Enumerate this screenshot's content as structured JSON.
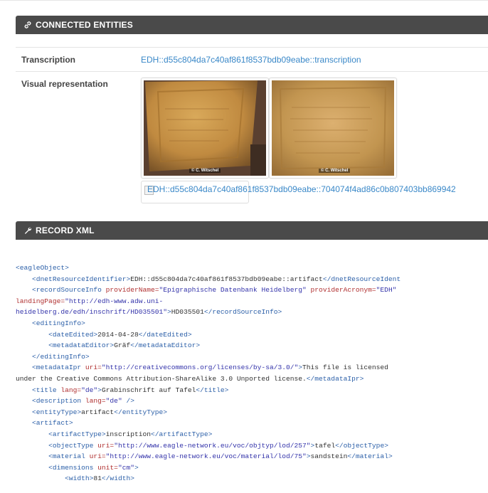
{
  "entities": {
    "title": "CONNECTED ENTITIES",
    "transcription_label": "Transcription",
    "transcription_link": "EDH::d55c804da7c40af861f8537bdb09eabe::transcription",
    "visual_label": "Visual representation",
    "images": [
      {
        "credit": "© C. Witschel"
      },
      {
        "credit": "© C. Witschel"
      }
    ],
    "broken_image_alt": "EDH::d55c804da7c40af861f8537bdb09eabe::704074f4ad86c0b807403bb869942"
  },
  "xml_panel": {
    "title": "RECORD XML",
    "lines": [
      {
        "indent": 0,
        "parts": [
          {
            "c": "tg",
            "t": "<eagleObject>"
          }
        ]
      },
      {
        "indent": 1,
        "parts": [
          {
            "c": "tg",
            "t": "<dnetResourceIdentifier>"
          },
          {
            "c": "tx",
            "t": "EDH::d55c804da7c40af861f8537bdb09eabe::artifact"
          },
          {
            "c": "tg",
            "t": "</dnetResourceIdent"
          }
        ]
      },
      {
        "indent": 1,
        "parts": [
          {
            "c": "tg",
            "t": "<recordSourceInfo "
          },
          {
            "c": "an",
            "t": "providerName="
          },
          {
            "c": "av",
            "t": "\"Epigraphische Datenbank Heidelberg\" "
          },
          {
            "c": "an",
            "t": "providerAcronym="
          },
          {
            "c": "av",
            "t": "\"EDH\""
          }
        ]
      },
      {
        "indent": 0,
        "parts": [
          {
            "c": "an",
            "t": "landingPage="
          },
          {
            "c": "av",
            "t": "\"http://edh-www.adw.uni-"
          }
        ]
      },
      {
        "indent": 0,
        "parts": [
          {
            "c": "av",
            "t": "heidelberg.de/edh/inschrift/HD035501\""
          },
          {
            "c": "tg",
            "t": ">"
          },
          {
            "c": "tx",
            "t": "HD035501"
          },
          {
            "c": "tg",
            "t": "</recordSourceInfo>"
          }
        ]
      },
      {
        "indent": 1,
        "parts": [
          {
            "c": "tg",
            "t": "<editingInfo>"
          }
        ]
      },
      {
        "indent": 2,
        "parts": [
          {
            "c": "tg",
            "t": "<dateEdited>"
          },
          {
            "c": "tx",
            "t": "2014-04-28"
          },
          {
            "c": "tg",
            "t": "</dateEdited>"
          }
        ]
      },
      {
        "indent": 2,
        "parts": [
          {
            "c": "tg",
            "t": "<metadataEditor>"
          },
          {
            "c": "tx",
            "t": "Gräf"
          },
          {
            "c": "tg",
            "t": "</metadataEditor>"
          }
        ]
      },
      {
        "indent": 1,
        "parts": [
          {
            "c": "tg",
            "t": "</editingInfo>"
          }
        ]
      },
      {
        "indent": 1,
        "parts": [
          {
            "c": "tg",
            "t": "<metadataIpr "
          },
          {
            "c": "an",
            "t": "uri="
          },
          {
            "c": "av",
            "t": "\"http://creativecommons.org/licenses/by-sa/3.0/\""
          },
          {
            "c": "tg",
            "t": ">"
          },
          {
            "c": "tx",
            "t": "This file is licensed"
          }
        ]
      },
      {
        "indent": 0,
        "parts": [
          {
            "c": "tx",
            "t": "under the Creative Commons Attribution-ShareAlike 3.0 Unported license."
          },
          {
            "c": "tg",
            "t": "</metadataIpr>"
          }
        ]
      },
      {
        "indent": 1,
        "parts": [
          {
            "c": "tg",
            "t": "<title "
          },
          {
            "c": "an",
            "t": "lang="
          },
          {
            "c": "av",
            "t": "\"de\""
          },
          {
            "c": "tg",
            "t": ">"
          },
          {
            "c": "tx",
            "t": "Grabinschrift auf Tafel"
          },
          {
            "c": "tg",
            "t": "</title>"
          }
        ]
      },
      {
        "indent": 1,
        "parts": [
          {
            "c": "tg",
            "t": "<description "
          },
          {
            "c": "an",
            "t": "lang="
          },
          {
            "c": "av",
            "t": "\"de\" "
          },
          {
            "c": "tg",
            "t": "/>"
          }
        ]
      },
      {
        "indent": 1,
        "parts": [
          {
            "c": "tg",
            "t": "<entityType>"
          },
          {
            "c": "tx",
            "t": "artifact"
          },
          {
            "c": "tg",
            "t": "</entityType>"
          }
        ]
      },
      {
        "indent": 1,
        "parts": [
          {
            "c": "tg",
            "t": "<artifact>"
          }
        ]
      },
      {
        "indent": 2,
        "parts": [
          {
            "c": "tg",
            "t": "<artifactType>"
          },
          {
            "c": "tx",
            "t": "inscription"
          },
          {
            "c": "tg",
            "t": "</artifactType>"
          }
        ]
      },
      {
        "indent": 2,
        "parts": [
          {
            "c": "tg",
            "t": "<objectType "
          },
          {
            "c": "an",
            "t": "uri="
          },
          {
            "c": "av",
            "t": "\"http://www.eagle-network.eu/voc/objtyp/lod/257\""
          },
          {
            "c": "tg",
            "t": ">"
          },
          {
            "c": "tx",
            "t": "tafel"
          },
          {
            "c": "tg",
            "t": "</objectType>"
          }
        ]
      },
      {
        "indent": 2,
        "parts": [
          {
            "c": "tg",
            "t": "<material "
          },
          {
            "c": "an",
            "t": "uri="
          },
          {
            "c": "av",
            "t": "\"http://www.eagle-network.eu/voc/material/lod/75\""
          },
          {
            "c": "tg",
            "t": ">"
          },
          {
            "c": "tx",
            "t": "sandstein"
          },
          {
            "c": "tg",
            "t": "</material>"
          }
        ]
      },
      {
        "indent": 2,
        "parts": [
          {
            "c": "tg",
            "t": "<dimensions "
          },
          {
            "c": "an",
            "t": "unit="
          },
          {
            "c": "av",
            "t": "\"cm\""
          },
          {
            "c": "tg",
            "t": ">"
          }
        ]
      },
      {
        "indent": 3,
        "parts": [
          {
            "c": "tg",
            "t": "<width>"
          },
          {
            "c": "tx",
            "t": "81"
          },
          {
            "c": "tg",
            "t": "</width>"
          }
        ]
      }
    ]
  }
}
